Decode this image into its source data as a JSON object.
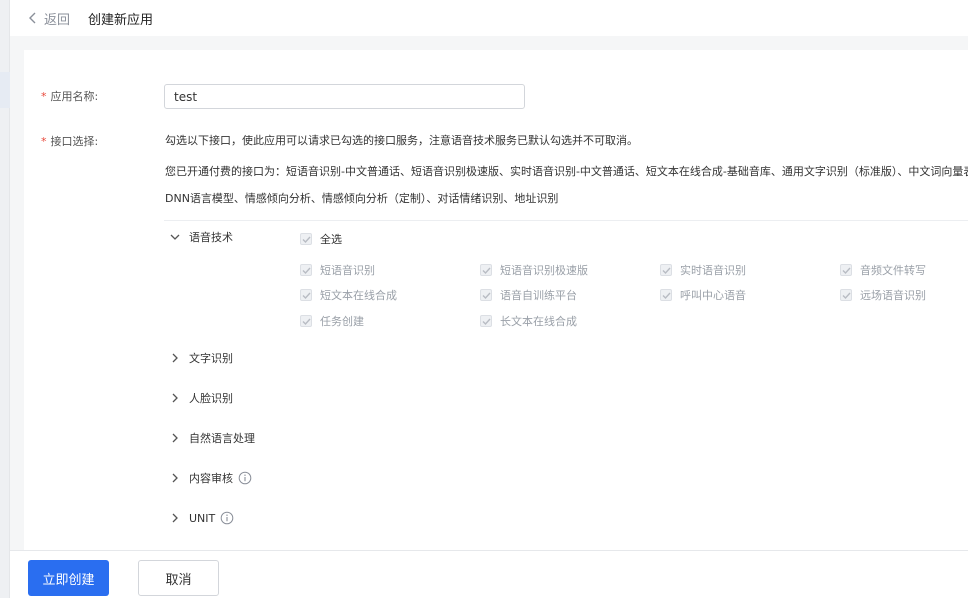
{
  "header": {
    "back_label": "返回",
    "title": "创建新应用"
  },
  "form": {
    "name_label": "应用名称:",
    "name_value": "test",
    "interface_label": "接口选择:",
    "required_mark": "*",
    "note_1": "勾选以下接口，使此应用可以请求已勾选的接口服务，注意语音技术服务已默认勾选并不可取消。",
    "note_2": "您已开通付费的接口为：短语音识别-中文普通话、短语音识别极速版、实时语音识别-中文普通话、短文本在线合成-基础音库、通用文字识别（标准版）、中文词向量表示",
    "note_3": "DNN语言模型、情感倾向分析、情感倾向分析（定制）、对话情绪识别、地址识别"
  },
  "categories": [
    {
      "label": "语音技术",
      "expanded": true,
      "info": false
    },
    {
      "label": "文字识别",
      "expanded": false,
      "info": false
    },
    {
      "label": "人脸识别",
      "expanded": false,
      "info": false
    },
    {
      "label": "自然语言处理",
      "expanded": false,
      "info": false
    },
    {
      "label": "内容审核",
      "expanded": false,
      "info": true
    },
    {
      "label": "UNIT",
      "expanded": false,
      "info": true
    }
  ],
  "speech": {
    "select_all": "全选",
    "items": [
      "短语音识别",
      "短语音识别极速版",
      "实时语音识别",
      "音频文件转写",
      "短文本在线合成",
      "语音自训练平台",
      "呼叫中心语音",
      "远场语音识别",
      "任务创建",
      "长文本在线合成"
    ]
  },
  "footer": {
    "create_label": "立即创建",
    "cancel_label": "取消"
  },
  "colors": {
    "primary": "#2a6ef0",
    "required": "#e8483a",
    "disabled_text": "#9aa0a8"
  }
}
